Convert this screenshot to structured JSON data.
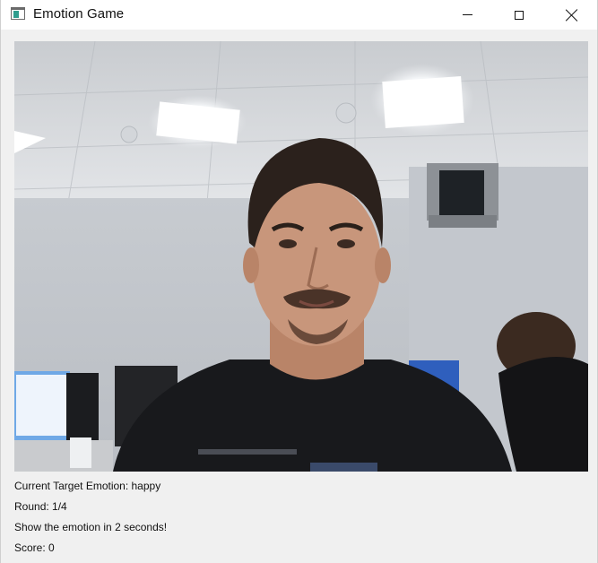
{
  "window": {
    "title": "Emotion Game",
    "icon": "app-window-icon",
    "controls": [
      "minimize-icon",
      "maximize-icon",
      "close-icon"
    ]
  },
  "video": {
    "icon": "webcam-frame"
  },
  "status": {
    "target_emotion": "Current Target Emotion: happy",
    "round": "Round: 1/4",
    "prompt": "Show the emotion in 2 seconds!",
    "score": "Score: 0"
  },
  "colors": {
    "window_bg": "#f0f0f0",
    "titlebar_bg": "#ffffff",
    "text": "#111111"
  }
}
